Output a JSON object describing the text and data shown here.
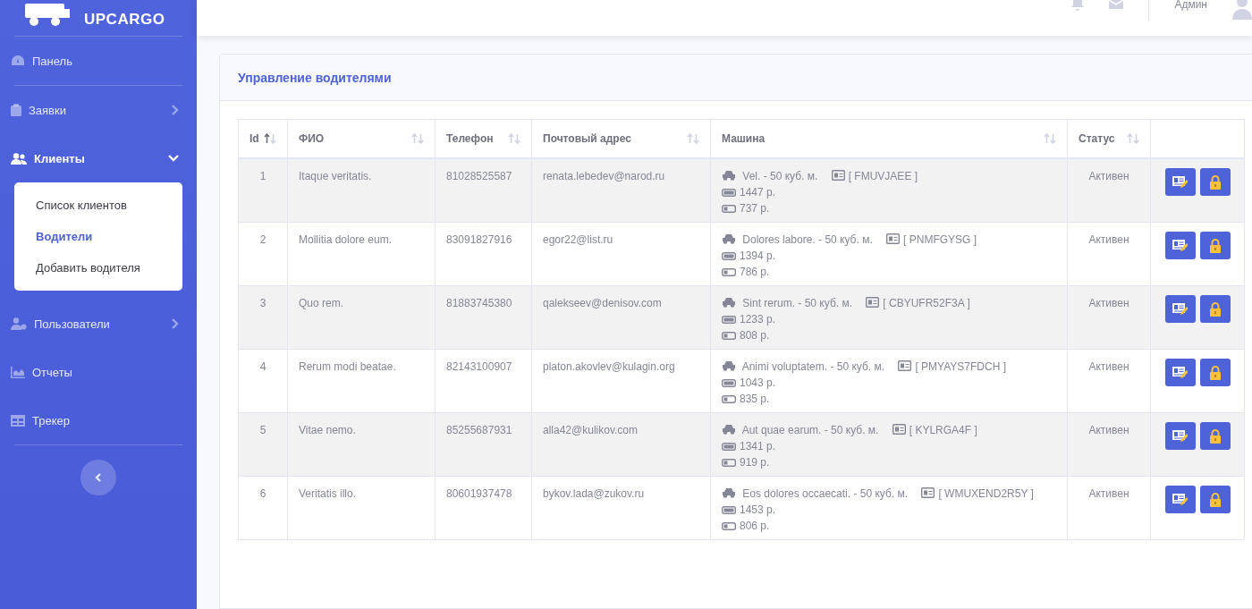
{
  "brand": {
    "name": "UPCARGO"
  },
  "sidebar": {
    "items": [
      {
        "label": "Панель",
        "kind": "plain"
      },
      {
        "label": "Заявки",
        "kind": "group",
        "expanded": false
      },
      {
        "label": "Клиенты",
        "kind": "group",
        "expanded": true,
        "children": [
          {
            "label": "Список клиентов",
            "selected": false
          },
          {
            "label": "Водители",
            "selected": true
          },
          {
            "label": "Добавить водителя",
            "selected": false
          }
        ]
      },
      {
        "label": "Пользователи",
        "kind": "group",
        "expanded": false
      },
      {
        "label": "Отчеты",
        "kind": "plain"
      },
      {
        "label": "Трекер",
        "kind": "plain"
      }
    ]
  },
  "topbar": {
    "user": "Админ"
  },
  "card": {
    "title": "Управление водителями"
  },
  "table": {
    "columns": [
      {
        "label": "Id",
        "sorted": true
      },
      {
        "label": "ФИО",
        "sorted": false
      },
      {
        "label": "Телефон",
        "sorted": false
      },
      {
        "label": "Почтовый адрес",
        "sorted": false
      },
      {
        "label": "Машина",
        "sorted": false
      },
      {
        "label": "Статус",
        "sorted": false
      }
    ],
    "rows": [
      {
        "id": "1",
        "name": "Itaque veritatis.",
        "phone": "81028525587",
        "email": "renata.lebedev@narod.ru",
        "car": "Vel. - 50 куб. м.",
        "plate": "[ FMUVJAEE ]",
        "price_1": "1447 р.",
        "price_2": "737 р.",
        "status": "Активен"
      },
      {
        "id": "2",
        "name": "Mollitia dolore eum.",
        "phone": "83091827916",
        "email": "egor22@list.ru",
        "car": "Dolores labore. - 50 куб. м.",
        "plate": "[ PNMFGYSG ]",
        "price_1": "1394 р.",
        "price_2": "786 р.",
        "status": "Активен"
      },
      {
        "id": "3",
        "name": "Quo rem.",
        "phone": "81883745380",
        "email": "qalekseev@denisov.com",
        "car": "Sint rerum. - 50 куб. м.",
        "plate": "[ CBYUFR52F3A ]",
        "price_1": "1233 р.",
        "price_2": "808 р.",
        "status": "Активен"
      },
      {
        "id": "4",
        "name": "Rerum modi beatae.",
        "phone": "82143100907",
        "email": "platon.akovlev@kulagin.org",
        "car": "Animi voluptatem. - 50 куб. м.",
        "plate": "[ PMYAYS7FDCH ]",
        "price_1": "1043 р.",
        "price_2": "835 р.",
        "status": "Активен"
      },
      {
        "id": "5",
        "name": "Vitae nemo.",
        "phone": "85255687931",
        "email": "alla42@kulikov.com",
        "car": "Aut quae earum. - 50 куб. м.",
        "plate": "[ KYLRGA4F ]",
        "price_1": "1341 р.",
        "price_2": "919 р.",
        "status": "Активен"
      },
      {
        "id": "6",
        "name": "Veritatis illo.",
        "phone": "80601937478",
        "email": "bykov.lada@zukov.ru",
        "car": "Eos dolores occaecati. - 50 куб. м.",
        "plate": "[ WMUXEND2R5Y ]",
        "price_1": "1453 р.",
        "price_2": "806 р.",
        "status": "Активен"
      }
    ]
  }
}
